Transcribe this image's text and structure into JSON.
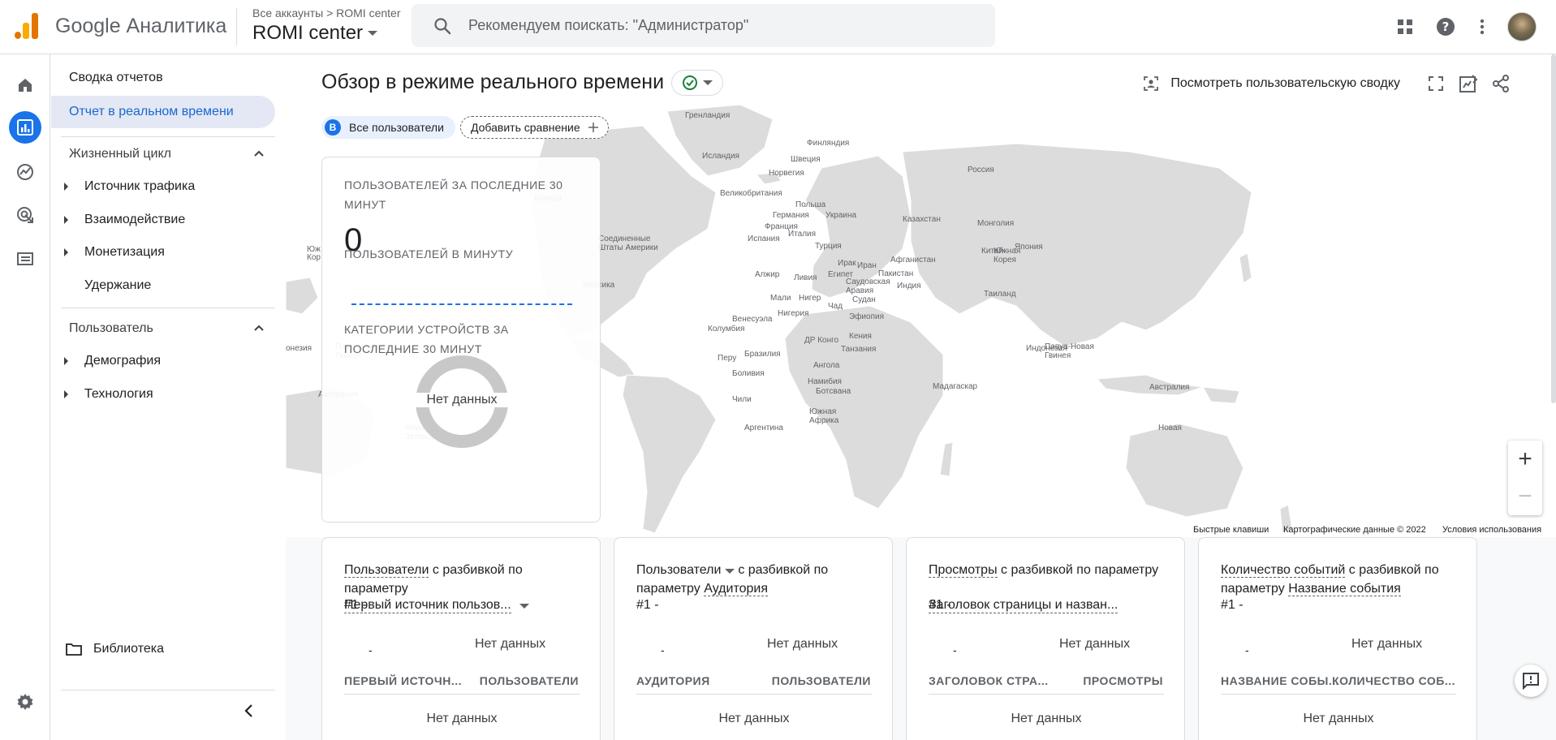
{
  "header": {
    "app_title": "Google Аналитика",
    "breadcrumb": "Все аккаунты  >  ROMI center",
    "account": "ROMI center",
    "search_placeholder": "Рекомендуем поискать: \"Администратор\""
  },
  "nav": {
    "reports_snapshot": "Сводка отчетов",
    "realtime": "Отчет в реальном времени",
    "lifecycle": {
      "title": "Жизненный цикл",
      "items": [
        "Источник трафика",
        "Взаимодействие",
        "Монетизация",
        "Удержание"
      ]
    },
    "user": {
      "title": "Пользователь",
      "items": [
        "Демография",
        "Технология"
      ]
    },
    "library": "Библиотека"
  },
  "main": {
    "page_title": "Обзор в режиме реального времени",
    "view_user_snapshot": "Посмотреть пользовательскую сводку",
    "chip_all_letter": "B",
    "chip_all": "Все пользователи",
    "chip_add": "Добавить сравнение"
  },
  "map": {
    "labels": [
      {
        "text": "Гренландия"
      },
      {
        "text": "Исландия"
      },
      {
        "text": "Финляндия"
      },
      {
        "text": "Швеция"
      },
      {
        "text": "Норвегия"
      },
      {
        "text": "Россия"
      },
      {
        "text": "Канада"
      },
      {
        "text": "Великобритания"
      },
      {
        "text": "Польша"
      },
      {
        "text": "Германия"
      },
      {
        "text": "Украина"
      },
      {
        "text": "Казахстан"
      },
      {
        "text": "Монголия"
      },
      {
        "text": "Франция"
      },
      {
        "text": "Италия"
      },
      {
        "text": "Испания"
      },
      {
        "text": "Соединенные\nШтаты Америки"
      },
      {
        "text": "Турция"
      },
      {
        "text": "Китай"
      },
      {
        "text": "Япония"
      },
      {
        "text": "Южная\nКорея"
      },
      {
        "text": "Ирак"
      },
      {
        "text": "Иран"
      },
      {
        "text": "Афганистан"
      },
      {
        "text": "Пакистан"
      },
      {
        "text": "Алжир"
      },
      {
        "text": "Ливия"
      },
      {
        "text": "Египет"
      },
      {
        "text": "Саудовская\nАравия"
      },
      {
        "text": "Индия"
      },
      {
        "text": "Мексика"
      },
      {
        "text": "Таиланд"
      },
      {
        "text": "Мали"
      },
      {
        "text": "Нигер"
      },
      {
        "text": "Чад"
      },
      {
        "text": "Судан"
      },
      {
        "text": "Нигерия"
      },
      {
        "text": "Эфиопия"
      },
      {
        "text": "Венесуэла"
      },
      {
        "text": "Колумбия"
      },
      {
        "text": "Кения"
      },
      {
        "text": "ДР Конго"
      },
      {
        "text": "Танзания"
      },
      {
        "text": "Индонезия"
      },
      {
        "text": "Папуа-Новая\nГвинея"
      },
      {
        "text": "Перу"
      },
      {
        "text": "Бразилия"
      },
      {
        "text": "Боливия"
      },
      {
        "text": "Ангола"
      },
      {
        "text": "Намибия"
      },
      {
        "text": "Мадагаскар"
      },
      {
        "text": "Ботсвана"
      },
      {
        "text": "Чили"
      },
      {
        "text": "Австралия"
      },
      {
        "text": "Южная\nАфрика"
      },
      {
        "text": "Аргентина"
      },
      {
        "text": "Новая\nЗеландия"
      },
      {
        "text": "Новая"
      },
      {
        "text": "онезия"
      },
      {
        "text": "Папуа-Новая\nГвинея"
      },
      {
        "text": "Австралия"
      },
      {
        "text": "Юж"
      },
      {
        "text": "Кор"
      }
    ],
    "footer": {
      "shortcuts": "Быстрые клавиши",
      "map_data": "Картографические данные © 2022",
      "terms": "Условия использования"
    }
  },
  "realtime_card": {
    "users_30min_label": "ПОЛЬЗОВАТЕЛЕЙ ЗА ПОСЛЕДНИЕ 30 МИНУТ",
    "users_30min_value": "0",
    "users_per_minute_label": "ПОЛЬЗОВАТЕЛЕЙ В МИНУТУ",
    "device_label": "КАТЕГОРИИ УСТРОЙСТВ ЗА ПОСЛЕДНИЕ 30 МИНУТ",
    "no_data": "Нет данных"
  },
  "cards": [
    {
      "title_a": "Пользователи",
      "title_b": " с разбивкой по параметру",
      "sub_overlay": "#1  -",
      "sub": "Первый источник пользов...",
      "no_data": "Нет данных",
      "dash": "-",
      "col1": "ПЕРВЫЙ ИСТОЧН...",
      "col2": "ПОЛЬЗОВАТЕЛИ",
      "no_data_table": "Нет данных"
    },
    {
      "title_a": "Пользователи",
      "title_b": "  с разбивкой по параметру ",
      "title_c": "Аудитория",
      "sub": "#1  -",
      "no_data": "Нет данных",
      "dash": "-",
      "col1": "АУДИТОРИЯ",
      "col2": "ПОЛЬЗОВАТЕЛИ",
      "no_data_table": "Нет данных"
    },
    {
      "title_a": "Просмотры",
      "title_b": " с разбивкой по параметру",
      "sub_overlay": "#1  -",
      "sub": "Заголовок страницы и назван...",
      "no_data": "Нет данных",
      "dash": "-",
      "col1": "ЗАГОЛОВОК СТРА...",
      "col2": "ПРОСМОТРЫ",
      "no_data_table": "Нет данных"
    },
    {
      "title_a": "Количество событий",
      "title_b": " с разбивкой по параметру ",
      "title_c": "Название события",
      "sub": "#1  -",
      "no_data": "Нет данных",
      "dash": "-",
      "col1": "НАЗВАНИЕ СОБЫ...",
      "col2": "КОЛИЧЕСТВО СОБ...",
      "no_data_table": "Нет данных"
    }
  ],
  "colors": {
    "accent": "#1a73e8",
    "active_nav_bg": "#e3e8f4",
    "map_land": "#dadada",
    "success": "#188038"
  }
}
